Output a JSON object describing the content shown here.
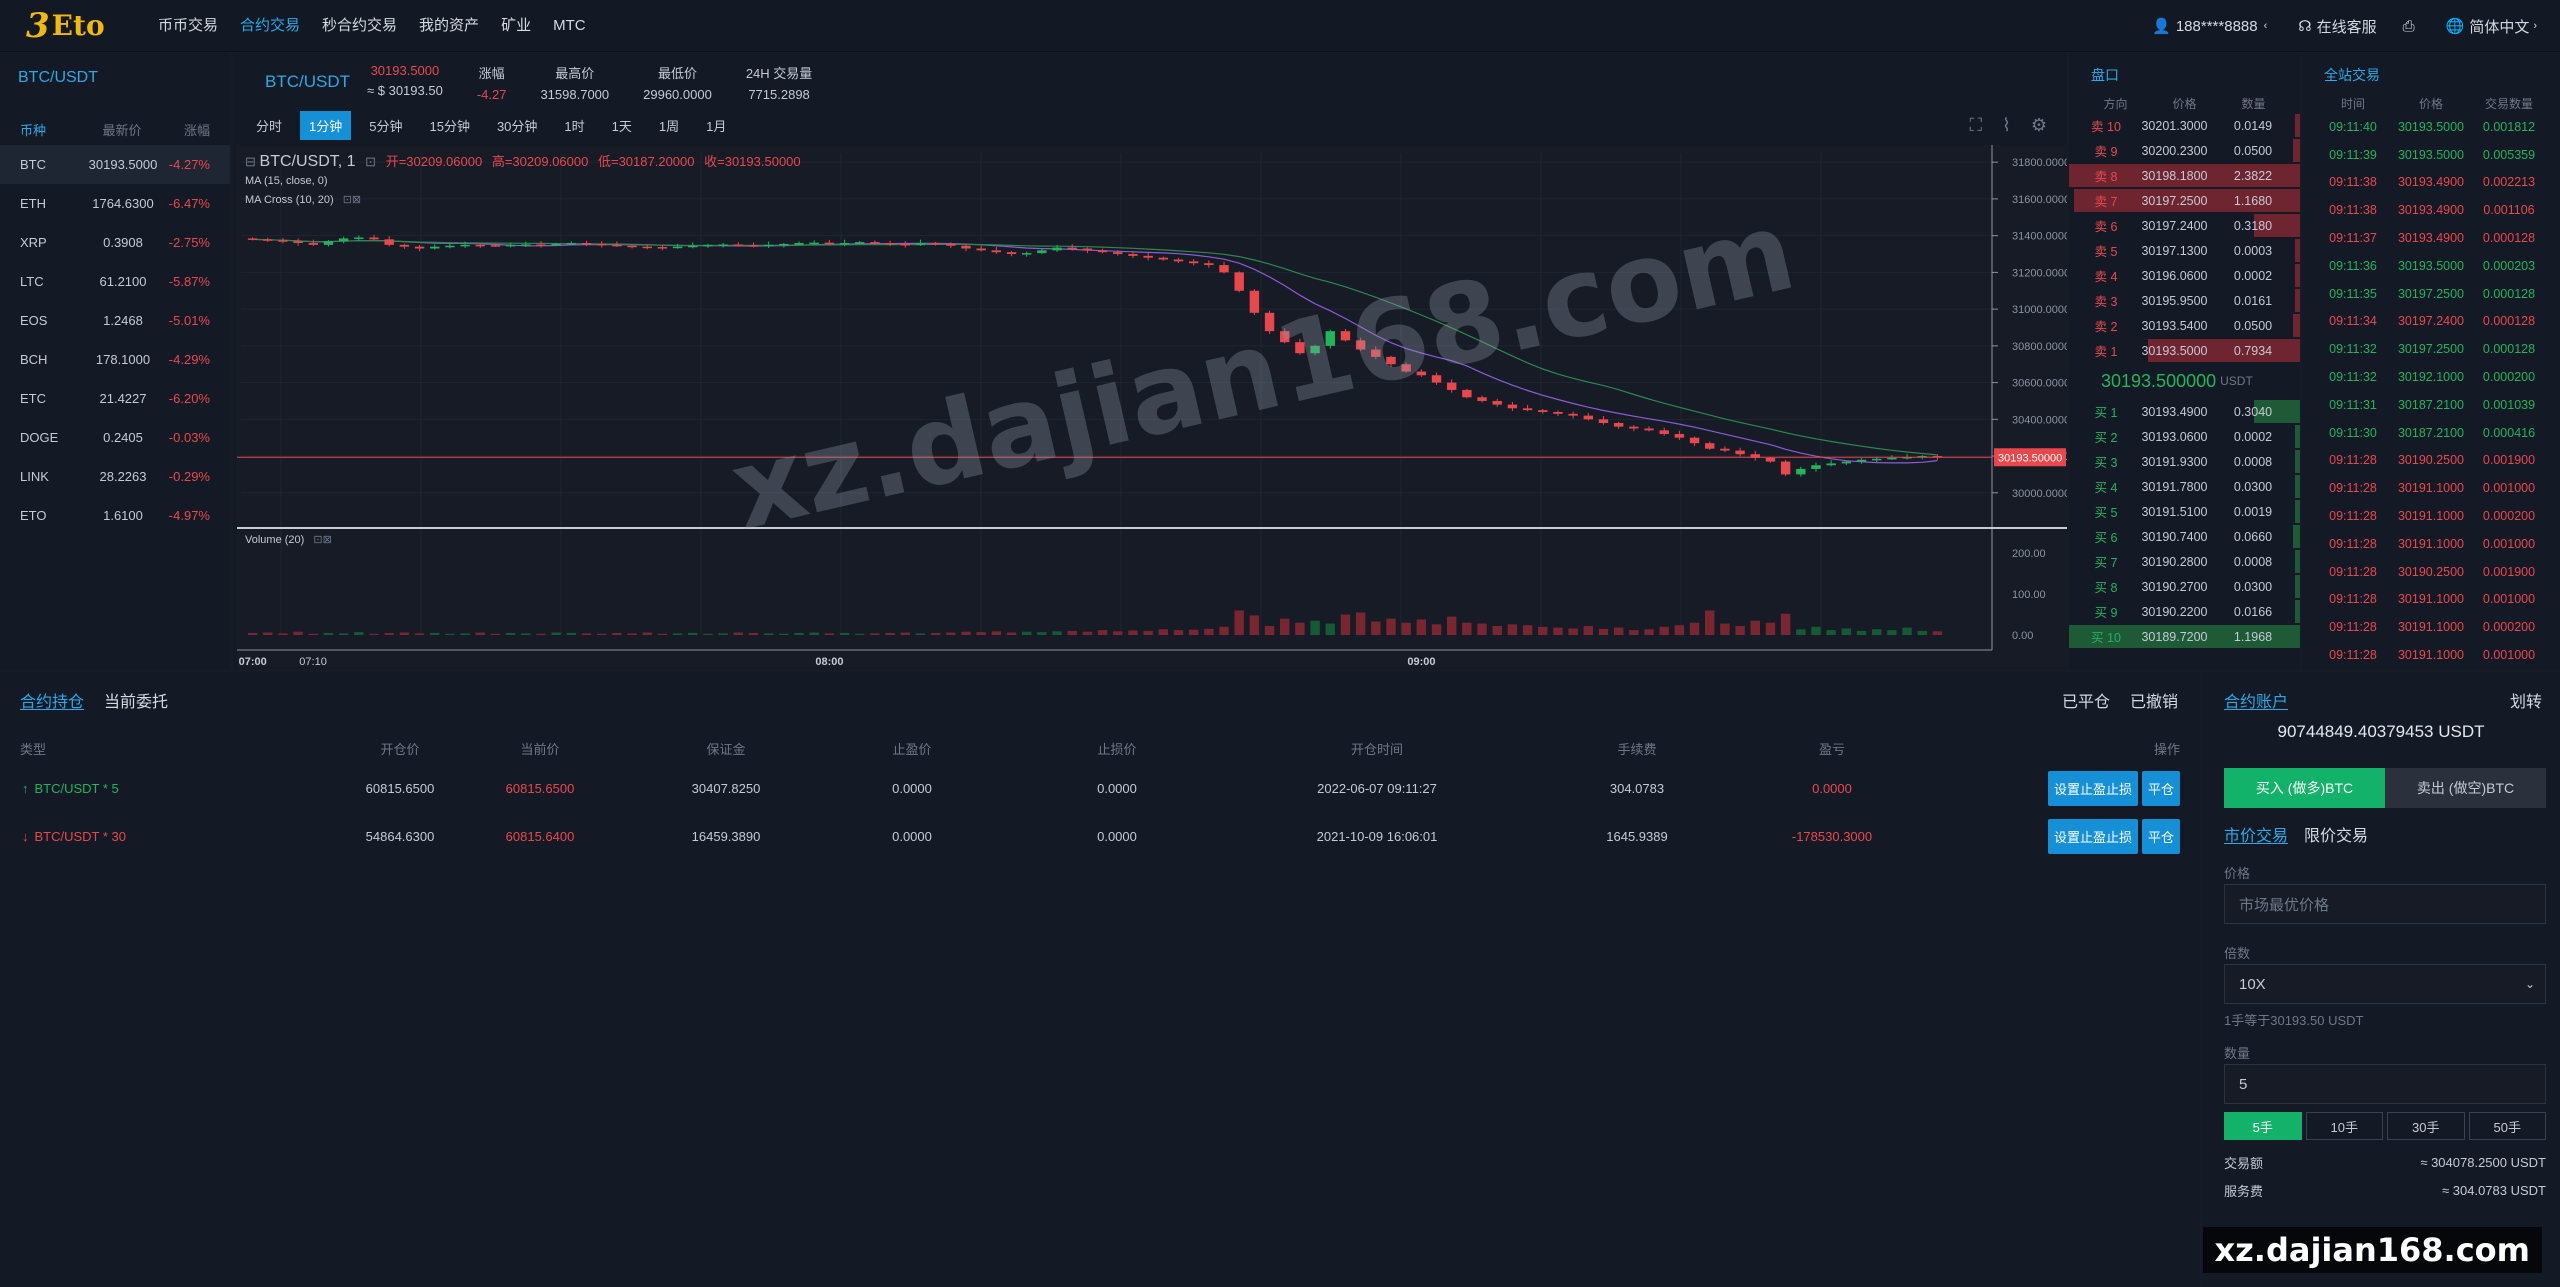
{
  "brand": {
    "mark": "3",
    "name": "Eto"
  },
  "nav": [
    {
      "label": "币币交易",
      "active": false
    },
    {
      "label": "合约交易",
      "active": true
    },
    {
      "label": "秒合约交易",
      "active": false
    },
    {
      "label": "我的资产",
      "active": false
    },
    {
      "label": "矿业",
      "active": false
    },
    {
      "label": "MTC",
      "active": false
    }
  ],
  "topright": {
    "user": "188****8888",
    "service": "在线客服",
    "language": "简体中文"
  },
  "market": {
    "title": "BTC/USDT",
    "head": [
      "币种",
      "最新价",
      "涨幅"
    ],
    "rows": [
      {
        "coin": "BTC",
        "price": "30193.5000",
        "change": "-4.27%"
      },
      {
        "coin": "ETH",
        "price": "1764.6300",
        "change": "-6.47%"
      },
      {
        "coin": "XRP",
        "price": "0.3908",
        "change": "-2.75%"
      },
      {
        "coin": "LTC",
        "price": "61.2100",
        "change": "-5.87%"
      },
      {
        "coin": "EOS",
        "price": "1.2468",
        "change": "-5.01%"
      },
      {
        "coin": "BCH",
        "price": "178.1000",
        "change": "-4.29%"
      },
      {
        "coin": "ETC",
        "price": "21.4227",
        "change": "-6.20%"
      },
      {
        "coin": "DOGE",
        "price": "0.2405",
        "change": "-0.03%"
      },
      {
        "coin": "LINK",
        "price": "28.2263",
        "change": "-0.29%"
      },
      {
        "coin": "ETO",
        "price": "1.6100",
        "change": "-4.97%"
      }
    ]
  },
  "ticker": {
    "symbol": "BTC/USDT",
    "last": "30193.5000",
    "last_usd": "≈ $ 30193.50",
    "change_label": "涨幅",
    "change": "-4.27",
    "high_label": "最高价",
    "high": "31598.7000",
    "low_label": "最低价",
    "low": "29960.0000",
    "vol_label": "24H 交易量",
    "vol": "7715.2898"
  },
  "intervals": [
    {
      "label": "分时",
      "active": false
    },
    {
      "label": "1分钟",
      "active": true
    },
    {
      "label": "5分钟",
      "active": false
    },
    {
      "label": "15分钟",
      "active": false
    },
    {
      "label": "30分钟",
      "active": false
    },
    {
      "label": "1时",
      "active": false
    },
    {
      "label": "1天",
      "active": false
    },
    {
      "label": "1周",
      "active": false
    },
    {
      "label": "1月",
      "active": false
    }
  ],
  "chart_data": {
    "type": "candlestick",
    "title": "BTC/USDT, 1",
    "ohlc_label": {
      "open": "开=30209.06000",
      "high": "高=30209.06000",
      "low": "低=30187.20000",
      "close": "收=30193.50000"
    },
    "indicators": [
      "MA (15, close, 0)",
      "MA Cross (10, 20)"
    ],
    "volume_label": "Volume (20)",
    "current_price_tag": "30193.50000",
    "y_ticks": [
      "31800.00000",
      "31600.00000",
      "31400.00000",
      "31200.00000",
      "31000.00000",
      "30800.00000",
      "30600.00000",
      "30400.00000",
      "30200.00000",
      "30000.00000"
    ],
    "ylim": [
      29890,
      31850
    ],
    "vol_ticks": [
      "200.00",
      "100.00",
      "0.00"
    ],
    "vol_ylim": [
      0,
      220
    ],
    "x_ticks": [
      "07:00",
      "07:10",
      "08:00",
      "09:00"
    ],
    "closes": [
      31380,
      31375,
      31370,
      31360,
      31350,
      31370,
      31385,
      31390,
      31380,
      31350,
      31340,
      31330,
      31340,
      31345,
      31350,
      31348,
      31345,
      31350,
      31352,
      31350,
      31355,
      31360,
      31355,
      31350,
      31345,
      31340,
      31338,
      31335,
      31340,
      31345,
      31350,
      31352,
      31348,
      31345,
      31350,
      31355,
      31360,
      31362,
      31358,
      31360,
      31365,
      31360,
      31355,
      31350,
      31360,
      31355,
      31345,
      31330,
      31320,
      31310,
      31300,
      31305,
      31320,
      31335,
      31330,
      31320,
      31310,
      31300,
      31290,
      31280,
      31270,
      31260,
      31250,
      31240,
      31200,
      31100,
      30980,
      30880,
      30820,
      30760,
      30800,
      30880,
      30830,
      30780,
      30740,
      30700,
      30660,
      30640,
      30600,
      30560,
      30520,
      30500,
      30480,
      30460,
      30450,
      30440,
      30430,
      30420,
      30400,
      30380,
      30360,
      30350,
      30340,
      30320,
      30300,
      30270,
      30240,
      30230,
      30210,
      30190,
      30170,
      30100,
      30130,
      30150,
      30160,
      30170,
      30180,
      30185,
      30190,
      30195,
      30200,
      30193
    ],
    "volumes": [
      5,
      6,
      4,
      8,
      3,
      5,
      4,
      7,
      3,
      5,
      6,
      4,
      5,
      3,
      4,
      6,
      3,
      5,
      4,
      3,
      6,
      5,
      4,
      3,
      5,
      4,
      6,
      3,
      4,
      5,
      3,
      4,
      6,
      5,
      4,
      3,
      5,
      6,
      4,
      5,
      3,
      4,
      5,
      6,
      4,
      5,
      6,
      8,
      7,
      9,
      6,
      8,
      7,
      9,
      10,
      8,
      12,
      9,
      11,
      10,
      14,
      12,
      13,
      15,
      20,
      60,
      48,
      22,
      40,
      30,
      35,
      28,
      50,
      55,
      33,
      40,
      30,
      38,
      26,
      45,
      30,
      28,
      22,
      26,
      24,
      20,
      18,
      16,
      22,
      15,
      18,
      12,
      14,
      20,
      24,
      30,
      60,
      28,
      22,
      35,
      30,
      52,
      14,
      20,
      12,
      16,
      10,
      14,
      12,
      18,
      10,
      9
    ],
    "ma1_color": "#8e5bd6",
    "ma2_color": "#2a8a4a",
    "up_color": "#21b45a",
    "down_color": "#e8484c"
  },
  "orderbook": {
    "title": "盘口",
    "head": [
      "方向",
      "价格",
      "数量"
    ],
    "asks": [
      {
        "side": "卖 10",
        "price": "30201.3000",
        "qty": "0.0149",
        "depth": 0.02
      },
      {
        "side": "卖 9",
        "price": "30200.2300",
        "qty": "0.0500",
        "depth": 0.03
      },
      {
        "side": "卖 8",
        "price": "30198.1800",
        "qty": "2.3822",
        "depth": 1.0
      },
      {
        "side": "卖 7",
        "price": "30197.2500",
        "qty": "1.1680",
        "depth": 0.98
      },
      {
        "side": "卖 6",
        "price": "30197.2400",
        "qty": "0.3180",
        "depth": 0.2
      },
      {
        "side": "卖 5",
        "price": "30197.1300",
        "qty": "0.0003",
        "depth": 0.01
      },
      {
        "side": "卖 4",
        "price": "30196.0600",
        "qty": "0.0002",
        "depth": 0.01
      },
      {
        "side": "卖 3",
        "price": "30195.9500",
        "qty": "0.0161",
        "depth": 0.02
      },
      {
        "side": "卖 2",
        "price": "30193.5400",
        "qty": "0.0500",
        "depth": 0.03
      },
      {
        "side": "卖 1",
        "price": "30193.5000",
        "qty": "0.7934",
        "depth": 0.66
      }
    ],
    "mid_price": "30193.500000",
    "mid_unit": "USDT",
    "bids": [
      {
        "side": "买 1",
        "price": "30193.4900",
        "qty": "0.3040",
        "depth": 0.2
      },
      {
        "side": "买 2",
        "price": "30193.0600",
        "qty": "0.0002",
        "depth": 0.01
      },
      {
        "side": "买 3",
        "price": "30191.9300",
        "qty": "0.0008",
        "depth": 0.01
      },
      {
        "side": "买 4",
        "price": "30191.7800",
        "qty": "0.0300",
        "depth": 0.02
      },
      {
        "side": "买 5",
        "price": "30191.5100",
        "qty": "0.0019",
        "depth": 0.01
      },
      {
        "side": "买 6",
        "price": "30190.7400",
        "qty": "0.0660",
        "depth": 0.03
      },
      {
        "side": "买 7",
        "price": "30190.2800",
        "qty": "0.0008",
        "depth": 0.01
      },
      {
        "side": "买 8",
        "price": "30190.2700",
        "qty": "0.0300",
        "depth": 0.02
      },
      {
        "side": "买 9",
        "price": "30190.2200",
        "qty": "0.0166",
        "depth": 0.02
      },
      {
        "side": "买 10",
        "price": "30189.7200",
        "qty": "1.1968",
        "depth": 1.0
      }
    ]
  },
  "trades": {
    "title": "全站交易",
    "head": [
      "时间",
      "价格",
      "交易数量"
    ],
    "rows": [
      {
        "time": "09:11:40",
        "price": "30193.5000",
        "qty": "0.001812",
        "side": "buy"
      },
      {
        "time": "09:11:39",
        "price": "30193.5000",
        "qty": "0.005359",
        "side": "buy"
      },
      {
        "time": "09:11:38",
        "price": "30193.4900",
        "qty": "0.002213",
        "side": "sell"
      },
      {
        "time": "09:11:38",
        "price": "30193.4900",
        "qty": "0.001106",
        "side": "sell"
      },
      {
        "time": "09:11:37",
        "price": "30193.4900",
        "qty": "0.000128",
        "side": "sell"
      },
      {
        "time": "09:11:36",
        "price": "30193.5000",
        "qty": "0.000203",
        "side": "buy"
      },
      {
        "time": "09:11:35",
        "price": "30197.2500",
        "qty": "0.000128",
        "side": "buy"
      },
      {
        "time": "09:11:34",
        "price": "30197.2400",
        "qty": "0.000128",
        "side": "sell"
      },
      {
        "time": "09:11:32",
        "price": "30197.2500",
        "qty": "0.000128",
        "side": "buy"
      },
      {
        "time": "09:11:32",
        "price": "30192.1000",
        "qty": "0.000200",
        "side": "buy"
      },
      {
        "time": "09:11:31",
        "price": "30187.2100",
        "qty": "0.001039",
        "side": "buy"
      },
      {
        "time": "09:11:30",
        "price": "30187.2100",
        "qty": "0.000416",
        "side": "buy"
      },
      {
        "time": "09:11:28",
        "price": "30190.2500",
        "qty": "0.001900",
        "side": "sell"
      },
      {
        "time": "09:11:28",
        "price": "30191.1000",
        "qty": "0.001000",
        "side": "sell"
      },
      {
        "time": "09:11:28",
        "price": "30191.1000",
        "qty": "0.000200",
        "side": "sell"
      },
      {
        "time": "09:11:28",
        "price": "30191.1000",
        "qty": "0.001000",
        "side": "sell"
      },
      {
        "time": "09:11:28",
        "price": "30190.2500",
        "qty": "0.001900",
        "side": "sell"
      },
      {
        "time": "09:11:28",
        "price": "30191.1000",
        "qty": "0.001000",
        "side": "sell"
      },
      {
        "time": "09:11:28",
        "price": "30191.1000",
        "qty": "0.000200",
        "side": "sell"
      },
      {
        "time": "09:11:28",
        "price": "30191.1000",
        "qty": "0.001000",
        "side": "sell"
      }
    ]
  },
  "positions": {
    "tabs": [
      {
        "label": "合约持仓",
        "active": true
      },
      {
        "label": "当前委托",
        "active": false
      }
    ],
    "right_tabs": [
      "已平仓",
      "已撤销"
    ],
    "head": [
      "类型",
      "开仓价",
      "当前价",
      "保证金",
      "止盈价",
      "止损价",
      "开仓时间",
      "手续费",
      "盈亏",
      "操作"
    ],
    "rows": [
      {
        "dir": "up",
        "arrow": "↑",
        "type": "BTC/USDT * 5",
        "open": "60815.6500",
        "current": "60815.6500",
        "margin": "30407.8250",
        "tp": "0.0000",
        "sl": "0.0000",
        "time": "2022-06-07 09:11:27",
        "fee": "304.0783",
        "pnl": "0.0000",
        "btn1": "设置止盈止损",
        "btn2": "平仓"
      },
      {
        "dir": "down",
        "arrow": "↓",
        "type": "BTC/USDT * 30",
        "open": "54864.6300",
        "current": "60815.6400",
        "margin": "16459.3890",
        "tp": "0.0000",
        "sl": "0.0000",
        "time": "2021-10-09 16:06:01",
        "fee": "1645.9389",
        "pnl": "-178530.3000",
        "btn1": "设置止盈止损",
        "btn2": "平仓"
      }
    ]
  },
  "account": {
    "title": "合约账户",
    "transfer": "划转",
    "balance": "90744849.40379453 USDT",
    "buy": "买入 (做多)BTC",
    "sell": "卖出 (做空)BTC",
    "modes": [
      "市价交易",
      "限价交易"
    ],
    "price_label": "价格",
    "price_placeholder": "市场最优价格",
    "leverage_label": "倍数",
    "leverage": "10X",
    "lot_hint": "1手等于30193.50 USDT",
    "qty_label": "数量",
    "qty": "5",
    "lots": [
      {
        "label": "5手",
        "active": true
      },
      {
        "label": "10手",
        "active": false
      },
      {
        "label": "30手",
        "active": false
      },
      {
        "label": "50手",
        "active": false
      }
    ],
    "amount_label": "交易额",
    "amount": "≈ 304078.2500 USDT",
    "fee_label": "服务费",
    "fee": "≈ 304.0783 USDT"
  },
  "watermark": "xz.dajian168.com",
  "corner_watermark": "xz.dajian168.com"
}
